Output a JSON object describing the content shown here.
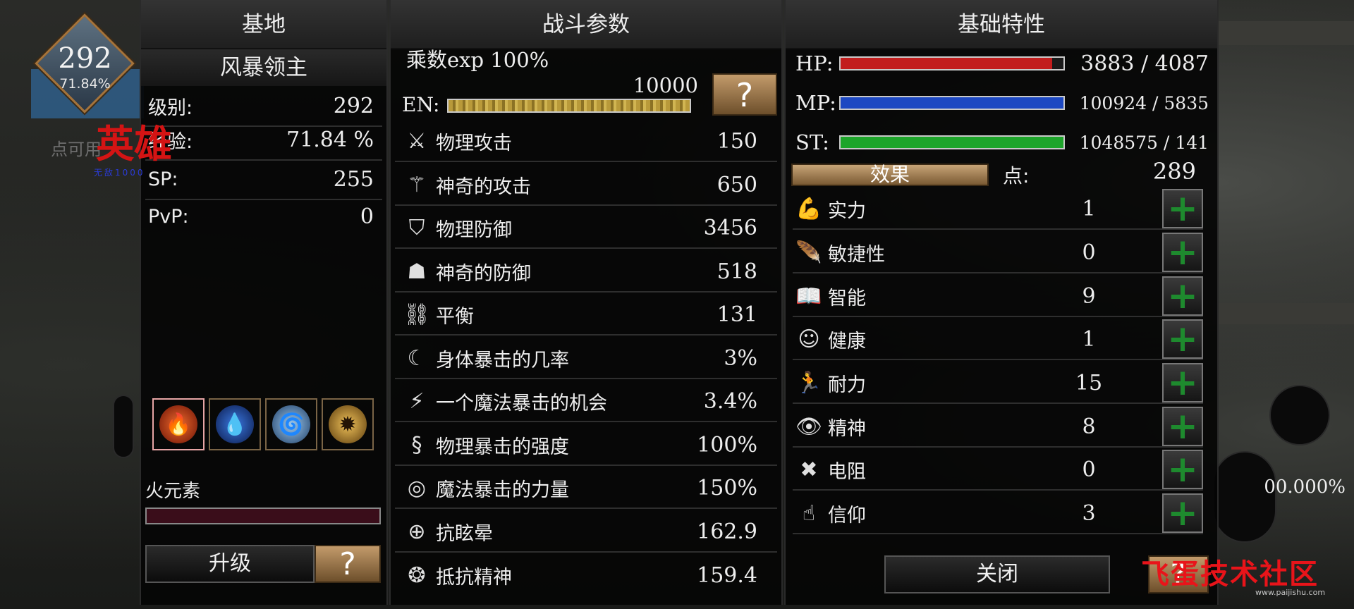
{
  "player": {
    "level": "292",
    "exp_percent": "71.84%",
    "hero_label": "英雄",
    "faint_label": "点可用",
    "tiny_label": "无敌1000"
  },
  "base_panel": {
    "title": "基地",
    "char_name": "风暴领主",
    "rows": [
      {
        "label": "级别:",
        "value": "292"
      },
      {
        "label": "经验:",
        "value": "71.84  %"
      },
      {
        "label": "SP:",
        "value": "255"
      },
      {
        "label": "PvP:",
        "value": "0"
      }
    ],
    "elements": [
      {
        "name": "fire-element-icon",
        "glyph": "🔥",
        "color": "#c93a16"
      },
      {
        "name": "water-element-icon",
        "glyph": "💧",
        "color": "#1e4aa8"
      },
      {
        "name": "wind-element-icon",
        "glyph": "🌀",
        "color": "#3f7fbf"
      },
      {
        "name": "light-element-icon",
        "glyph": "✹",
        "color": "#c7962e"
      }
    ],
    "selected_element": "火元素",
    "element_percent": "00.000%",
    "element_progress": 0,
    "upgrade_label": "升级",
    "help_label": "?"
  },
  "combat_panel": {
    "title": "战斗参数",
    "multiplier": "乘数exp 100%",
    "en_label": "EN:",
    "en_value": "10000",
    "help_label": "?",
    "stats": [
      {
        "icon": "crossed-swords-icon",
        "glyph": "⚔",
        "label": "物理攻击",
        "value": "150"
      },
      {
        "icon": "magic-wand-icon",
        "glyph": "⚚",
        "label": "神奇的攻击",
        "value": "650"
      },
      {
        "icon": "helmet-icon",
        "glyph": "⛉",
        "label": "物理防御",
        "value": "3456"
      },
      {
        "icon": "hooded-figure-icon",
        "glyph": "☗",
        "label": "神奇的防御",
        "value": "518"
      },
      {
        "icon": "chain-icon",
        "glyph": "⛓",
        "label": "平衡",
        "value": "131"
      },
      {
        "icon": "claw-icon",
        "glyph": "☾",
        "label": "身体暴击的几率",
        "value": "3%"
      },
      {
        "icon": "sword-spark-icon",
        "glyph": "⚡",
        "label": "一个魔法暴击的机会",
        "value": "3.4%"
      },
      {
        "icon": "dragon-icon",
        "glyph": "§",
        "label": "物理暴击的强度",
        "value": "100%"
      },
      {
        "icon": "vortex-icon",
        "glyph": "◎",
        "label": "魔法暴击的力量",
        "value": "150%"
      },
      {
        "icon": "target-icon",
        "glyph": "⊕",
        "label": "抗眩晕",
        "value": "162.9"
      },
      {
        "icon": "spirit-shield-icon",
        "glyph": "❂",
        "label": "抵抗精神",
        "value": "159.4"
      }
    ]
  },
  "attr_panel": {
    "title": "基础特性",
    "bars": [
      {
        "label": "HP:",
        "value": "3883 / 4087",
        "color": "#c21d1d",
        "fill": 0.95
      },
      {
        "label": "MP:",
        "value": "100924 / 5835",
        "color": "#1d48c2",
        "fill": 1
      },
      {
        "label": "ST:",
        "value": "1048575 / 141",
        "color": "#1da52a",
        "fill": 1
      }
    ],
    "effect_label": "效果",
    "points_label": "点:",
    "points_value": "289",
    "attrs": [
      {
        "icon": "muscle-arm-icon",
        "glyph": "💪",
        "label": "实力",
        "value": "1"
      },
      {
        "icon": "feather-icon",
        "glyph": "🪶",
        "label": "敏捷性",
        "value": "0"
      },
      {
        "icon": "book-icon",
        "glyph": "📖",
        "label": "智能",
        "value": "9"
      },
      {
        "icon": "head-icon",
        "glyph": "☺",
        "label": "健康",
        "value": "1"
      },
      {
        "icon": "runner-icon",
        "glyph": "🏃",
        "label": "耐力",
        "value": "15"
      },
      {
        "icon": "eye-icon",
        "glyph": "👁",
        "label": "精神",
        "value": "8"
      },
      {
        "icon": "cross-bones-icon",
        "glyph": "✖",
        "label": "电阻",
        "value": "0"
      },
      {
        "icon": "praying-hand-icon",
        "glyph": "☝",
        "label": "信仰",
        "value": "3"
      }
    ],
    "plus_label": "+",
    "close_label": "关闭",
    "help_label": "?"
  },
  "watermark": {
    "text": "飞蛋技术社区",
    "url": "www.paijishu.com"
  }
}
